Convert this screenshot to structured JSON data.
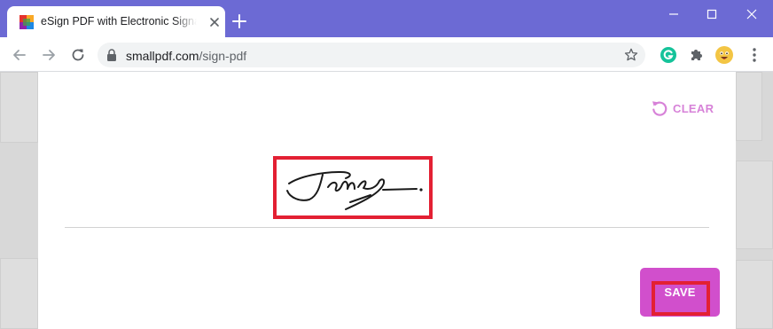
{
  "browser": {
    "tab_title": "eSign PDF with Electronic Signature",
    "url_host": "smallpdf.com",
    "url_path": "/sign-pdf",
    "theme_color": "#6c6ad4"
  },
  "extensions": [
    "grammarly-icon",
    "puzzle-icon",
    "profile-avatar",
    "menu-icon"
  ],
  "signature_dialog": {
    "clear_label": "CLEAR",
    "save_label": "SAVE",
    "accent_color": "#d14fcc",
    "highlight_color": "#e32033"
  }
}
